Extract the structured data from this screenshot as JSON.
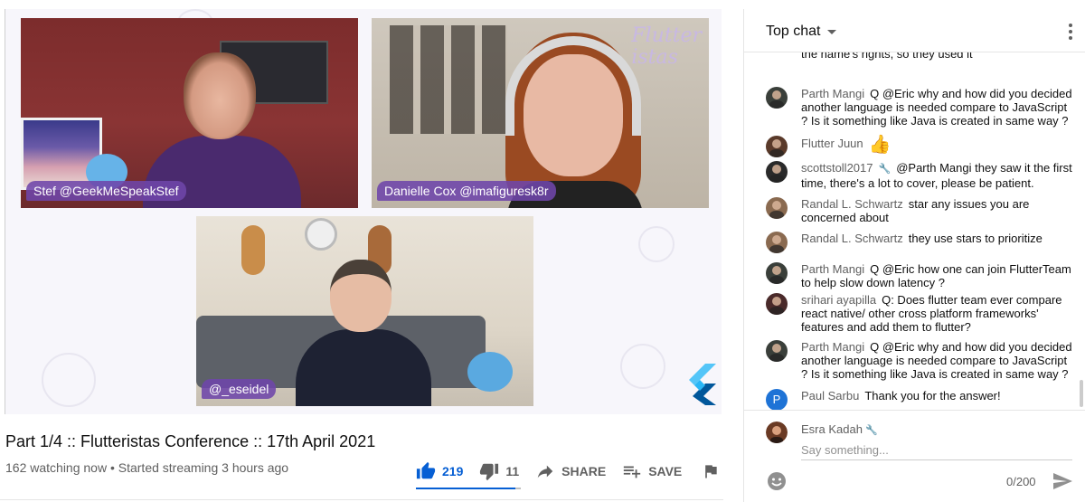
{
  "video": {
    "tiles": [
      {
        "name": "Stef",
        "label": "Stef @GeekMeSpeakStef"
      },
      {
        "name": "Danielle",
        "label": "Danielle Cox @imafiguresk8r"
      },
      {
        "name": "Eseidel",
        "label": "@_eseidel"
      }
    ],
    "overlay_logo": "Flutter\nistas"
  },
  "title": "Part 1/4 :: Flutteristas Conference :: 17th April 2021",
  "meta": "162 watching now • Started streaming 3 hours ago",
  "actions": {
    "like_count": "219",
    "dislike_count": "11",
    "share_label": "SHARE",
    "save_label": "SAVE",
    "like_ratio": 0.952
  },
  "chat": {
    "mode_label": "Top chat",
    "messages": [
      {
        "author": "",
        "text": "the name's rights, so they used it",
        "avatar_color": "#ffffff",
        "moderator": false
      },
      {
        "author": "Parth Mangi",
        "text": "Q @Eric why and how did you decided another language is needed compare to JavaScript ? Is it something like Java is created in same way ?",
        "avatar_color": "#3a3f3a",
        "moderator": false
      },
      {
        "author": "Flutter Juun",
        "text": "👍",
        "avatar_color": "#5a3a2a",
        "moderator": false
      },
      {
        "author": "scottstoll2017",
        "text": "@Parth Mangi they saw it the first time, there's a lot to cover, please be patient.",
        "avatar_color": "#2a2a2a",
        "moderator": true
      },
      {
        "author": "Randal L. Schwartz",
        "text": "star any issues you are concerned about",
        "avatar_color": "#8a6a50",
        "moderator": false
      },
      {
        "author": "Randal L. Schwartz",
        "text": "they use stars to prioritize",
        "avatar_color": "#8a6a50",
        "moderator": false
      },
      {
        "author": "Parth Mangi",
        "text": "Q @Eric how one can join FlutterTeam to help slow down latency ?",
        "avatar_color": "#3a3f3a",
        "moderator": false
      },
      {
        "author": "srihari ayapilla",
        "text": "Q: Does flutter team ever compare react native/ other cross platform frameworks' features and add them to flutter?",
        "avatar_color": "#4a2a2a",
        "moderator": false
      },
      {
        "author": "Parth Mangi",
        "text": "Q @Eric why and how did you decided another language is needed compare to JavaScript ? Is it something like Java is created in same way ?",
        "avatar_color": "#3a3f3a",
        "moderator": false
      },
      {
        "author": "Paul Sarbu",
        "text": "Thank you for the answer!",
        "avatar_color": "#1e73d6",
        "avatar_letter": "P",
        "moderator": false
      }
    ],
    "input": {
      "author": "Esra Kadah",
      "placeholder": "Say something...",
      "char_count": "0/200"
    }
  },
  "colors": {
    "accent": "#065fd4",
    "label_bg": "#6e46aa",
    "moderator_wrench": "#3e82f7"
  }
}
